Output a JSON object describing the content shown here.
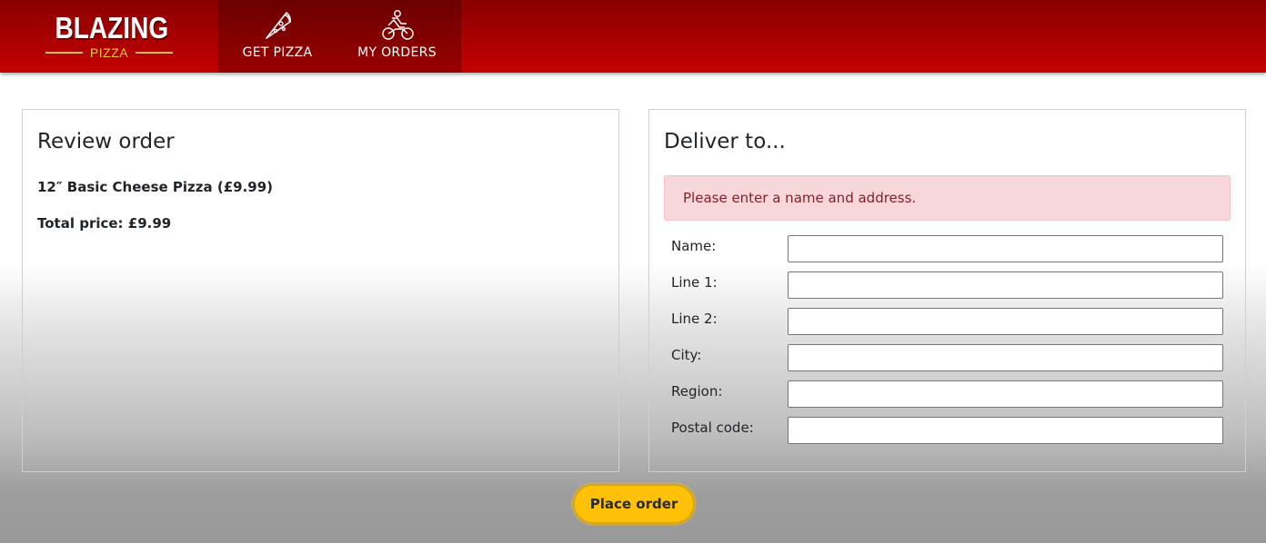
{
  "brand": {
    "name": "BLAZING",
    "subtitle": "PIZZA",
    "accent_color": "#f6c445",
    "header_color": "#c40000"
  },
  "nav": {
    "tabs": [
      {
        "label": "GET PIZZA",
        "icon": "pizza-slice-icon"
      },
      {
        "label": "MY ORDERS",
        "icon": "motorbike-icon"
      }
    ]
  },
  "review": {
    "title": "Review order",
    "items": [
      {
        "text": "12″ Basic Cheese Pizza (£9.99)"
      }
    ],
    "total_label": "Total price: £9.99"
  },
  "deliver": {
    "title": "Deliver to...",
    "alert": "Please enter a name and address.",
    "alert_color": "#f8d7da",
    "fields": [
      {
        "label": "Name:",
        "value": ""
      },
      {
        "label": "Line 1:",
        "value": ""
      },
      {
        "label": "Line 2:",
        "value": ""
      },
      {
        "label": "City:",
        "value": ""
      },
      {
        "label": "Region:",
        "value": ""
      },
      {
        "label": "Postal code:",
        "value": ""
      }
    ]
  },
  "actions": {
    "place_order": "Place order",
    "button_color": "#ffc107"
  }
}
